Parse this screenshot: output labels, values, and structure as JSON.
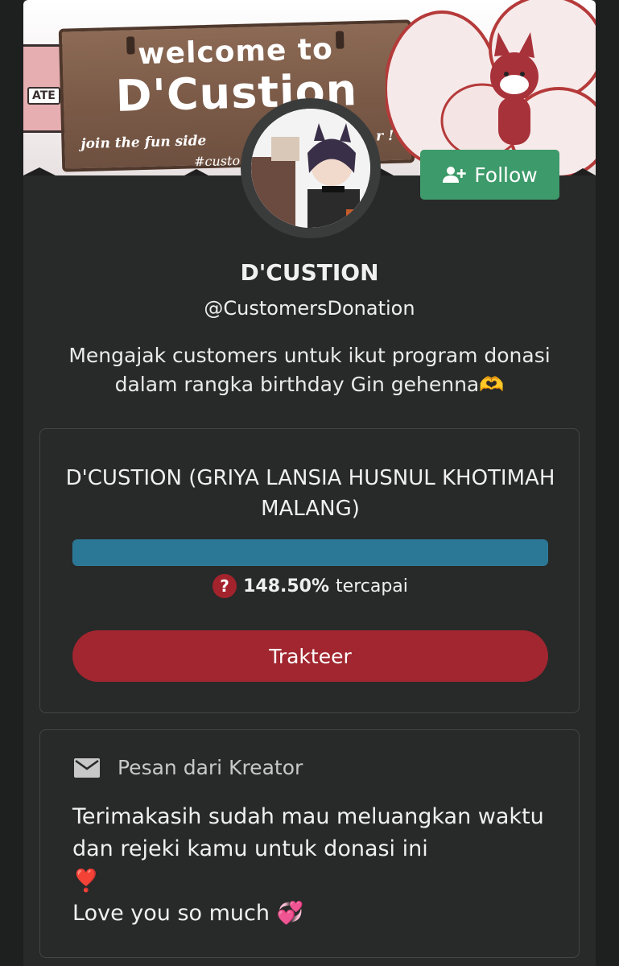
{
  "banner": {
    "welcome": "welcome to",
    "brand": "D'Custion",
    "tagline": "join the fun side",
    "tagline_end": "r !",
    "hashtag": "#custo",
    "box_label": "ATE"
  },
  "follow": {
    "label": "Follow",
    "color": "#3d9a6a"
  },
  "profile": {
    "name": "D'CUSTION",
    "handle": "@CustomersDonation",
    "bio": "Mengajak customers untuk ikut program donasi dalam rangka birthday Gin gehenna🫶"
  },
  "goal": {
    "title": "D'CUSTION (GRIYA LANSIA HUSNUL KHOTIMAH MALANG)",
    "progress_percent": 148.5,
    "progress_text": "148.50%",
    "progress_suffix": "tercapai",
    "help_symbol": "?",
    "button_label": "Trakteer",
    "button_color": "#a1262f",
    "bar_color": "#2a7896"
  },
  "message": {
    "header": "Pesan dari Kreator",
    "body": "Terimakasih sudah mau meluangkan waktu dan rejeki kamu untuk donasi ini\n❣️\nLove you so much 💞"
  },
  "icons": {
    "follow": "person-add-icon",
    "help": "question-icon",
    "mail": "mail-icon"
  }
}
